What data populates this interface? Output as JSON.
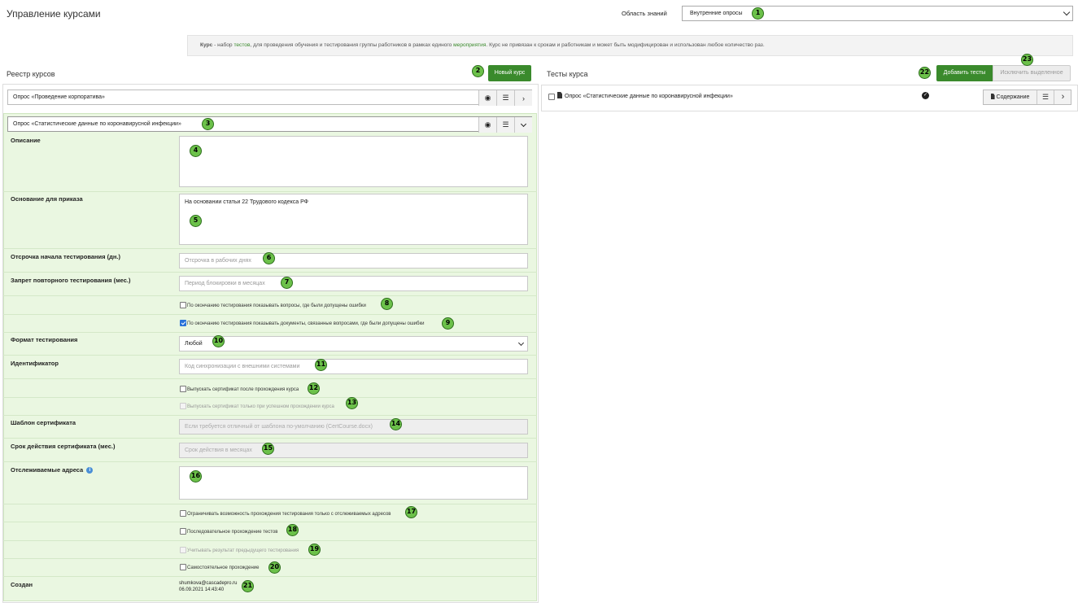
{
  "header": {
    "title": "Управление курсами",
    "knowledge_area_label": "Область знаний",
    "knowledge_area_value": "Внутренние опросы"
  },
  "info": {
    "bold": "Курс",
    "t1": " - набор ",
    "link1": "тестов",
    "t2": ", для проведения обучения и тестирования группы работников в рамках единого ",
    "link2": "мероприятия",
    "t3": ". Курс не привязан к срокам и работникам и может быть модифицирован и использован любое количество раз."
  },
  "registry": {
    "title": "Реестр курсов",
    "new_course_button": "Новый курс",
    "courses": [
      {
        "name": "Опрос «Проведение корпоратива»"
      },
      {
        "name": "Опрос «Статистические данные по коронавирусной инфекции»"
      }
    ]
  },
  "form": {
    "description_label": "Описание",
    "description_value": "",
    "order_basis_label": "Основание для приказа",
    "order_basis_value": "На основании статьи 22 Трудового кодекса РФ",
    "delay_label": "Отсрочка начала тестирования (дн.)",
    "delay_placeholder": "Отсрочка в рабочих днях",
    "retest_ban_label": "Запрет повторного тестирования (мес.)",
    "retest_ban_placeholder": "Период блокировки в месяцах",
    "show_mistakes_label": "По окончанию тестирования показывать вопросы, где были допущены ошибки",
    "show_docs_label": "По окончанию тестирования показывать документы, связанные вопросами, где были допущены ошибки",
    "format_label": "Формат тестирования",
    "format_value": "Любой",
    "identifier_label": "Идентификатор",
    "identifier_placeholder": "Код синхронизации с внешними системами",
    "cert_issue_label": "Выпускать сертификат после прохождения курса",
    "cert_success_label": "Выпускать сертификат только при успешном прохождении курса",
    "cert_template_label": "Шаблон сертификата",
    "cert_template_placeholder": "Если требуется отличный от шаблона по-умолчанию (CertCourse.docx)",
    "cert_validity_label": "Срок действия сертификата (мес.)",
    "cert_validity_placeholder": "Срок действия в месяцах",
    "tracked_addresses_label": "Отслеживаемые адреса",
    "restrict_addresses_label": "Ограничивать возможность прохождения тестирования только с отслеживаемых адресов",
    "sequential_label": "Последовательное прохождение тестов",
    "consider_previous_label": "Учитывать результат предыдущего тестирования",
    "self_paced_label": "Самостоятельное прохождение",
    "created_label": "Создан",
    "created_email": "shumkova@cascadepro.ru",
    "created_date": "06.09.2021 14:43:40"
  },
  "tests": {
    "title": "Тесты курса",
    "add_button": "Добавить тесты",
    "exclude_button": "Исключить выделенное",
    "items": [
      {
        "name": "Опрос «Статистические данные по коронавирусной инфекции»",
        "content_button": "Содержание"
      }
    ]
  },
  "badges": [
    "1",
    "2",
    "3",
    "4",
    "5",
    "6",
    "7",
    "8",
    "9",
    "10",
    "11",
    "12",
    "13",
    "14",
    "15",
    "16",
    "17",
    "18",
    "19",
    "20",
    "21",
    "22",
    "23"
  ]
}
